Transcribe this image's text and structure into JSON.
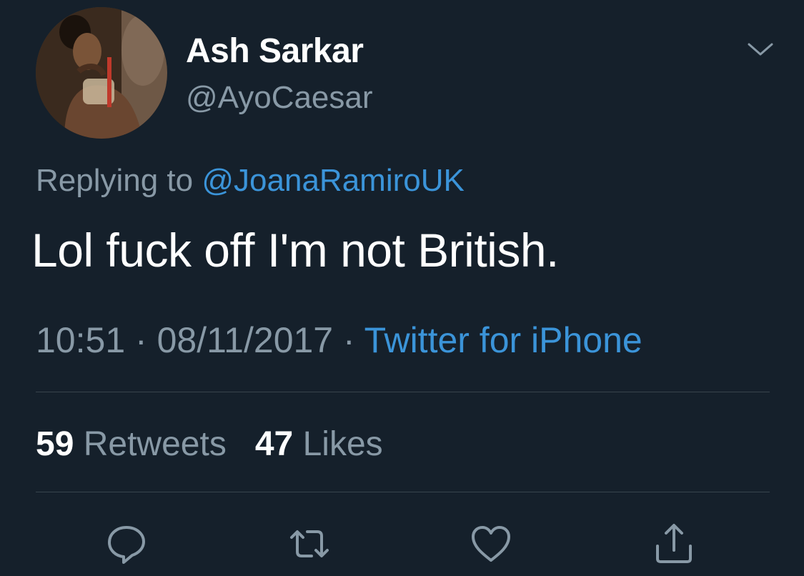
{
  "tweet": {
    "author": {
      "display_name": "Ash Sarkar",
      "handle": "@AyoCaesar"
    },
    "replying_to": {
      "prefix": "Replying to",
      "mention": "@JoanaRamiroUK"
    },
    "text": "Lol fuck off I'm not British.",
    "time": "10:51",
    "date": "08/11/2017",
    "source": "Twitter for iPhone",
    "stats": {
      "retweets_count": "59",
      "retweets_label": "Retweets",
      "likes_count": "47",
      "likes_label": "Likes"
    }
  },
  "icons": {
    "menu": "chevron-down-icon",
    "reply": "reply-icon",
    "retweet": "retweet-icon",
    "like": "heart-icon",
    "share": "share-icon"
  },
  "colors": {
    "background": "#15202b",
    "secondary_text": "#8899a6",
    "link": "#3b94d9",
    "divider": "#38444d"
  }
}
